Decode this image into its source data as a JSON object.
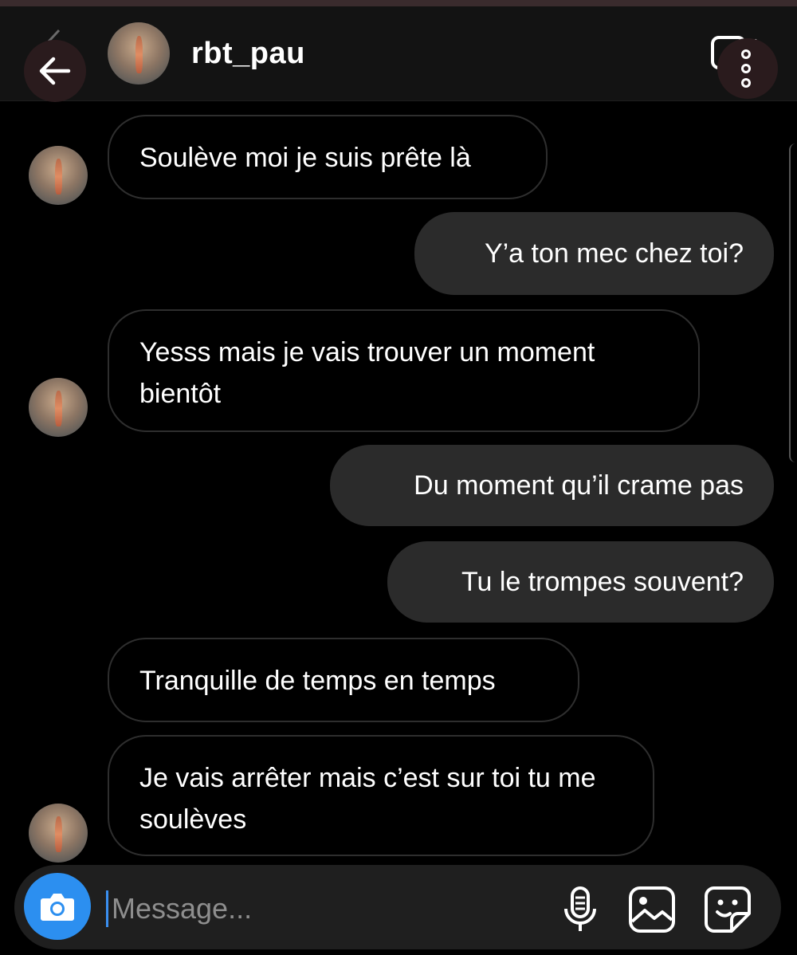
{
  "header": {
    "username": "rbt_pau"
  },
  "messages": [
    {
      "direction": "incoming",
      "text": "Soulève moi je suis prête là",
      "show_avatar": true
    },
    {
      "direction": "outgoing",
      "text": "Y’a ton mec chez toi?"
    },
    {
      "direction": "incoming",
      "text": "Yesss mais je vais trouver un moment bientôt",
      "show_avatar": true
    },
    {
      "direction": "outgoing",
      "text": "Du moment qu’il crame pas"
    },
    {
      "direction": "outgoing",
      "text": "Tu le trompes souvent?"
    },
    {
      "direction": "incoming",
      "text": "Tranquille de temps en temps",
      "show_avatar": false
    },
    {
      "direction": "incoming",
      "text": "Je vais arrêter mais c’est sur toi tu me soulèves",
      "show_avatar": true
    }
  ],
  "composer": {
    "placeholder": "Message...",
    "value": ""
  },
  "icons": {
    "back": "arrow-left-icon",
    "video": "video-camera-icon",
    "more": "more-vertical-icon",
    "camera": "camera-icon",
    "mic": "microphone-icon",
    "gallery": "image-gallery-icon",
    "sticker": "sticker-icon"
  },
  "colors": {
    "background": "#000000",
    "header": "#131313",
    "outgoing_bubble": "#2b2b2b",
    "incoming_border": "#2e2e2e",
    "camera_button": "#2c8ff0"
  }
}
